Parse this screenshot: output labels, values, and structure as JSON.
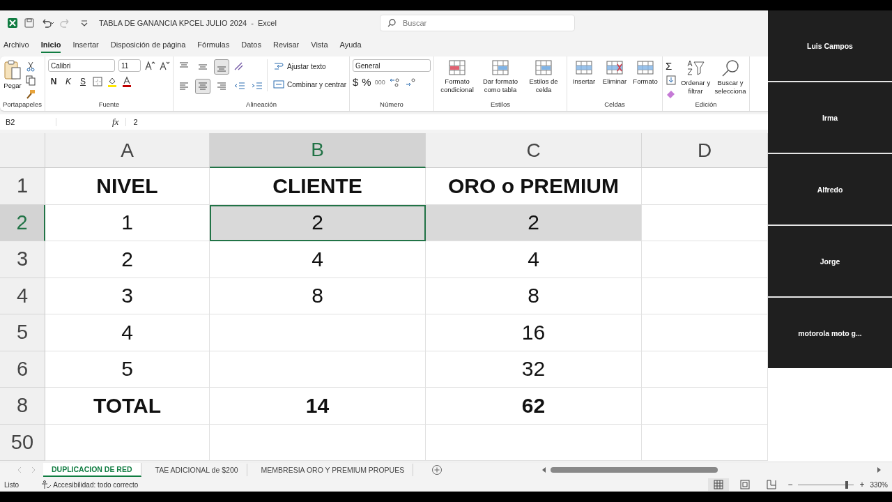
{
  "title_bar": {
    "title": "TABLA DE GANANCIA KPCEL JULIO 2024  -  Excel",
    "search": {
      "placeholder": "Buscar"
    }
  },
  "menu_tabs": [
    {
      "label": "Archivo",
      "selected": false
    },
    {
      "label": "Inicio",
      "selected": true
    },
    {
      "label": "Insertar",
      "selected": false
    },
    {
      "label": "Disposición de página",
      "selected": false
    },
    {
      "label": "Fórmulas",
      "selected": false
    },
    {
      "label": "Datos",
      "selected": false
    },
    {
      "label": "Revisar",
      "selected": false
    },
    {
      "label": "Vista",
      "selected": false
    },
    {
      "label": "Ayuda",
      "selected": false
    }
  ],
  "ribbon": {
    "clipboard": {
      "paste": "Pegar",
      "group": "Portapapeles"
    },
    "font": {
      "family": "Calibri",
      "size": "11",
      "bold": "N",
      "italic": "K",
      "underline": "S",
      "group": "Fuente"
    },
    "alignment": {
      "vertical": [
        {
          "selected": false
        },
        {
          "selected": false
        },
        {
          "selected": true
        }
      ],
      "horizontal": [
        {
          "selected": false
        },
        {
          "selected": true
        },
        {
          "selected": false
        }
      ],
      "wrap": "Ajustar texto",
      "merge": "Combinar y centrar",
      "group": "Alineación"
    },
    "number": {
      "format": "General",
      "currency": "$",
      "percent": "%",
      "thousands": "000",
      "group": "Número"
    },
    "styles": {
      "buttons": [
        "Formato condicional",
        "Dar formato como tabla",
        "Estilos de celda"
      ],
      "group": "Estilos"
    },
    "cells": {
      "buttons": [
        "Insertar",
        "Eliminar",
        "Formato"
      ],
      "group": "Celdas"
    },
    "editing": {
      "sum": "Σ",
      "buttons": [
        "Ordenar y filtrar",
        "Buscar y selecciona"
      ],
      "group": "Edición"
    }
  },
  "formula_bar": {
    "name_box": "B2",
    "fx": "fx",
    "value": "2"
  },
  "sheet": {
    "columns": [
      {
        "label": "A",
        "selected": false
      },
      {
        "label": "B",
        "selected": true
      },
      {
        "label": "C",
        "selected": false
      },
      {
        "label": "D",
        "selected": false
      }
    ],
    "rows": [
      {
        "number": "1",
        "selected": false,
        "bold": true,
        "cells": [
          {
            "value": "NIVEL",
            "shaded": false,
            "active": false
          },
          {
            "value": "CLIENTE",
            "shaded": false,
            "active": false
          },
          {
            "value": "ORO o PREMIUM",
            "shaded": false,
            "active": false
          }
        ]
      },
      {
        "number": "2",
        "selected": true,
        "bold": false,
        "cells": [
          {
            "value": "1",
            "shaded": false,
            "active": false
          },
          {
            "value": "2",
            "shaded": true,
            "active": true
          },
          {
            "value": "2",
            "shaded": true,
            "active": false
          }
        ]
      },
      {
        "number": "3",
        "selected": false,
        "bold": false,
        "cells": [
          {
            "value": "2",
            "shaded": false,
            "active": false
          },
          {
            "value": "4",
            "shaded": false,
            "active": false
          },
          {
            "value": "4",
            "shaded": false,
            "active": false
          }
        ]
      },
      {
        "number": "4",
        "selected": false,
        "bold": false,
        "cells": [
          {
            "value": "3",
            "shaded": false,
            "active": false
          },
          {
            "value": "8",
            "shaded": false,
            "active": false
          },
          {
            "value": "8",
            "shaded": false,
            "active": false
          }
        ]
      },
      {
        "number": "5",
        "selected": false,
        "bold": false,
        "cells": [
          {
            "value": "4",
            "shaded": false,
            "active": false
          },
          {
            "shaded": false,
            "active": false
          },
          {
            "value": "16",
            "shaded": false,
            "active": false
          }
        ]
      },
      {
        "number": "6",
        "selected": false,
        "bold": false,
        "cells": [
          {
            "value": "5",
            "shaded": false,
            "active": false
          },
          {
            "shaded": false,
            "active": false
          },
          {
            "value": "32",
            "shaded": false,
            "active": false
          }
        ]
      },
      {
        "number": "8",
        "selected": false,
        "bold": true,
        "cells": [
          {
            "value": "TOTAL",
            "shaded": false,
            "active": false
          },
          {
            "value": "14",
            "shaded": false,
            "active": false
          },
          {
            "value": "62",
            "shaded": false,
            "active": false
          }
        ]
      },
      {
        "number": "50",
        "selected": false,
        "cells": [
          {
            "shaded": false,
            "active": false
          },
          {
            "shaded": false,
            "active": false
          },
          {
            "shaded": false,
            "active": false
          }
        ]
      }
    ]
  },
  "sheet_tabs": [
    {
      "label": "DUPLICACION DE RED",
      "selected": true
    },
    {
      "label": "TAE ADICIONAL de $200",
      "selected": false
    },
    {
      "label": "MEMBRESIA ORO Y PREMIUM PROPUES",
      "selected": false
    }
  ],
  "status_bar": {
    "status": "Listo",
    "accessibility": "Accesibilidad: todo correcto",
    "views": [
      {
        "kind": "normal",
        "selected": true
      },
      {
        "kind": "page-layout",
        "selected": false
      },
      {
        "kind": "page-break",
        "selected": false
      }
    ],
    "zoom": {
      "zoom_out": "−",
      "zoom_in": "+",
      "level": 0.87,
      "reading": "330%"
    }
  },
  "participants": [
    {
      "name": "Luis Campos"
    },
    {
      "name": "Irma"
    },
    {
      "name": "Alfredo"
    },
    {
      "name": "Jorge"
    },
    {
      "name": "motorola moto g..."
    }
  ]
}
